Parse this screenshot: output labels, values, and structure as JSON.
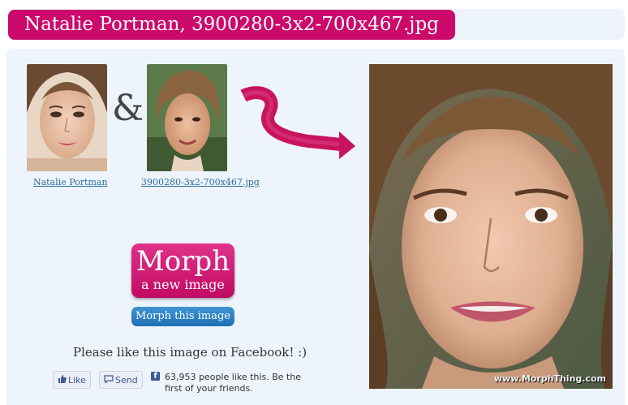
{
  "title": "Natalie Portman, 3900280-3x2-700x467.jpg",
  "images": {
    "first_caption": "Natalie Portman",
    "second_caption": "3900280-3x2-700x467.jpg",
    "ampersand": "&",
    "watermark": "www.MorphThing.com"
  },
  "buttons": {
    "morph_big": "Morph",
    "morph_small": "a new image",
    "morph_this": "Morph this image"
  },
  "facebook": {
    "prompt": "Please like this image on Facebook! :)",
    "like_label": "Like",
    "send_label": "Send",
    "logo": "f",
    "count_text": "63,953 people like this. Be the first of your friends."
  },
  "colors": {
    "accent_pink": "#cc0a6c",
    "button_blue": "#2a7dc4",
    "panel_bg": "#eef4fb",
    "facebook_blue": "#3b5998"
  }
}
